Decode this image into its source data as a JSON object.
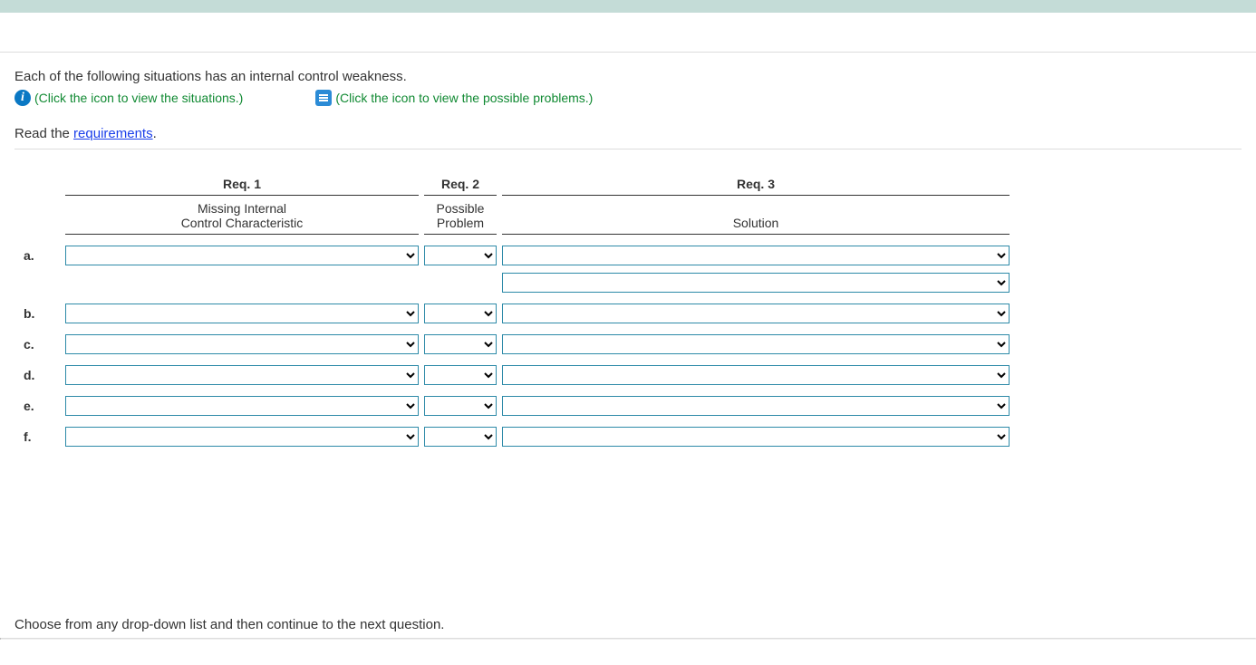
{
  "intro": "Each of the following situations has an internal control weakness.",
  "links": {
    "situations": "(Click the icon to view the situations.)",
    "problems": "(Click the icon to view the possible problems.)"
  },
  "read_prefix": "Read the ",
  "read_link": "requirements",
  "read_suffix": ".",
  "table": {
    "headers": {
      "req1": "Req. 1",
      "req2": "Req. 2",
      "req3": "Req. 3"
    },
    "subheaders": {
      "col1_line1": "Missing Internal",
      "col1_line2": "Control Characteristic",
      "col2_line1": "Possible",
      "col2_line2": "Problem",
      "col3_line1": "",
      "col3_line2": "Solution"
    },
    "rows": [
      {
        "label": "a."
      },
      {
        "label": "b."
      },
      {
        "label": "c."
      },
      {
        "label": "d."
      },
      {
        "label": "e."
      },
      {
        "label": "f."
      }
    ]
  },
  "footer": "Choose from any drop-down list and then continue to the next question."
}
